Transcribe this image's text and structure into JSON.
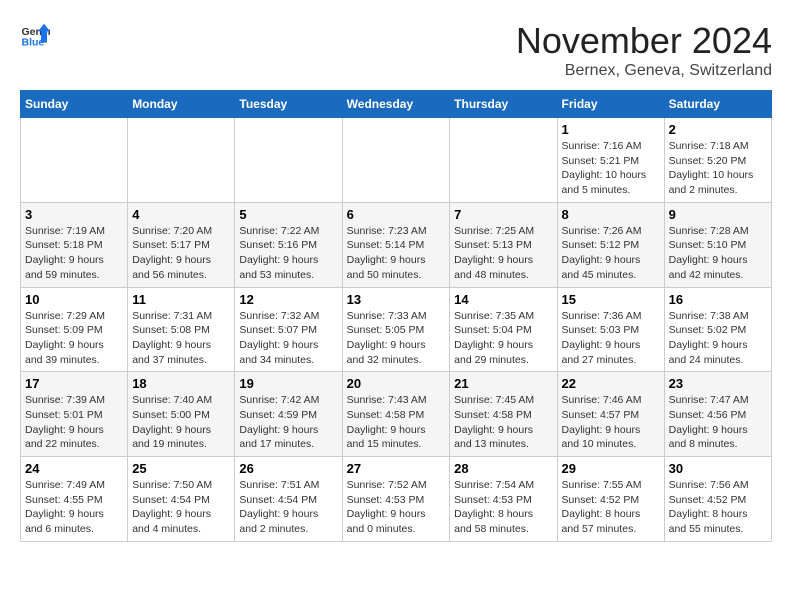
{
  "header": {
    "logo_general": "General",
    "logo_blue": "Blue",
    "title": "November 2024",
    "subtitle": "Bernex, Geneva, Switzerland"
  },
  "columns": [
    "Sunday",
    "Monday",
    "Tuesday",
    "Wednesday",
    "Thursday",
    "Friday",
    "Saturday"
  ],
  "weeks": [
    [
      {
        "day": "",
        "info": ""
      },
      {
        "day": "",
        "info": ""
      },
      {
        "day": "",
        "info": ""
      },
      {
        "day": "",
        "info": ""
      },
      {
        "day": "",
        "info": ""
      },
      {
        "day": "1",
        "info": "Sunrise: 7:16 AM\nSunset: 5:21 PM\nDaylight: 10 hours\nand 5 minutes."
      },
      {
        "day": "2",
        "info": "Sunrise: 7:18 AM\nSunset: 5:20 PM\nDaylight: 10 hours\nand 2 minutes."
      }
    ],
    [
      {
        "day": "3",
        "info": "Sunrise: 7:19 AM\nSunset: 5:18 PM\nDaylight: 9 hours\nand 59 minutes."
      },
      {
        "day": "4",
        "info": "Sunrise: 7:20 AM\nSunset: 5:17 PM\nDaylight: 9 hours\nand 56 minutes."
      },
      {
        "day": "5",
        "info": "Sunrise: 7:22 AM\nSunset: 5:16 PM\nDaylight: 9 hours\nand 53 minutes."
      },
      {
        "day": "6",
        "info": "Sunrise: 7:23 AM\nSunset: 5:14 PM\nDaylight: 9 hours\nand 50 minutes."
      },
      {
        "day": "7",
        "info": "Sunrise: 7:25 AM\nSunset: 5:13 PM\nDaylight: 9 hours\nand 48 minutes."
      },
      {
        "day": "8",
        "info": "Sunrise: 7:26 AM\nSunset: 5:12 PM\nDaylight: 9 hours\nand 45 minutes."
      },
      {
        "day": "9",
        "info": "Sunrise: 7:28 AM\nSunset: 5:10 PM\nDaylight: 9 hours\nand 42 minutes."
      }
    ],
    [
      {
        "day": "10",
        "info": "Sunrise: 7:29 AM\nSunset: 5:09 PM\nDaylight: 9 hours\nand 39 minutes."
      },
      {
        "day": "11",
        "info": "Sunrise: 7:31 AM\nSunset: 5:08 PM\nDaylight: 9 hours\nand 37 minutes."
      },
      {
        "day": "12",
        "info": "Sunrise: 7:32 AM\nSunset: 5:07 PM\nDaylight: 9 hours\nand 34 minutes."
      },
      {
        "day": "13",
        "info": "Sunrise: 7:33 AM\nSunset: 5:05 PM\nDaylight: 9 hours\nand 32 minutes."
      },
      {
        "day": "14",
        "info": "Sunrise: 7:35 AM\nSunset: 5:04 PM\nDaylight: 9 hours\nand 29 minutes."
      },
      {
        "day": "15",
        "info": "Sunrise: 7:36 AM\nSunset: 5:03 PM\nDaylight: 9 hours\nand 27 minutes."
      },
      {
        "day": "16",
        "info": "Sunrise: 7:38 AM\nSunset: 5:02 PM\nDaylight: 9 hours\nand 24 minutes."
      }
    ],
    [
      {
        "day": "17",
        "info": "Sunrise: 7:39 AM\nSunset: 5:01 PM\nDaylight: 9 hours\nand 22 minutes."
      },
      {
        "day": "18",
        "info": "Sunrise: 7:40 AM\nSunset: 5:00 PM\nDaylight: 9 hours\nand 19 minutes."
      },
      {
        "day": "19",
        "info": "Sunrise: 7:42 AM\nSunset: 4:59 PM\nDaylight: 9 hours\nand 17 minutes."
      },
      {
        "day": "20",
        "info": "Sunrise: 7:43 AM\nSunset: 4:58 PM\nDaylight: 9 hours\nand 15 minutes."
      },
      {
        "day": "21",
        "info": "Sunrise: 7:45 AM\nSunset: 4:58 PM\nDaylight: 9 hours\nand 13 minutes."
      },
      {
        "day": "22",
        "info": "Sunrise: 7:46 AM\nSunset: 4:57 PM\nDaylight: 9 hours\nand 10 minutes."
      },
      {
        "day": "23",
        "info": "Sunrise: 7:47 AM\nSunset: 4:56 PM\nDaylight: 9 hours\nand 8 minutes."
      }
    ],
    [
      {
        "day": "24",
        "info": "Sunrise: 7:49 AM\nSunset: 4:55 PM\nDaylight: 9 hours\nand 6 minutes."
      },
      {
        "day": "25",
        "info": "Sunrise: 7:50 AM\nSunset: 4:54 PM\nDaylight: 9 hours\nand 4 minutes."
      },
      {
        "day": "26",
        "info": "Sunrise: 7:51 AM\nSunset: 4:54 PM\nDaylight: 9 hours\nand 2 minutes."
      },
      {
        "day": "27",
        "info": "Sunrise: 7:52 AM\nSunset: 4:53 PM\nDaylight: 9 hours\nand 0 minutes."
      },
      {
        "day": "28",
        "info": "Sunrise: 7:54 AM\nSunset: 4:53 PM\nDaylight: 8 hours\nand 58 minutes."
      },
      {
        "day": "29",
        "info": "Sunrise: 7:55 AM\nSunset: 4:52 PM\nDaylight: 8 hours\nand 57 minutes."
      },
      {
        "day": "30",
        "info": "Sunrise: 7:56 AM\nSunset: 4:52 PM\nDaylight: 8 hours\nand 55 minutes."
      }
    ]
  ]
}
